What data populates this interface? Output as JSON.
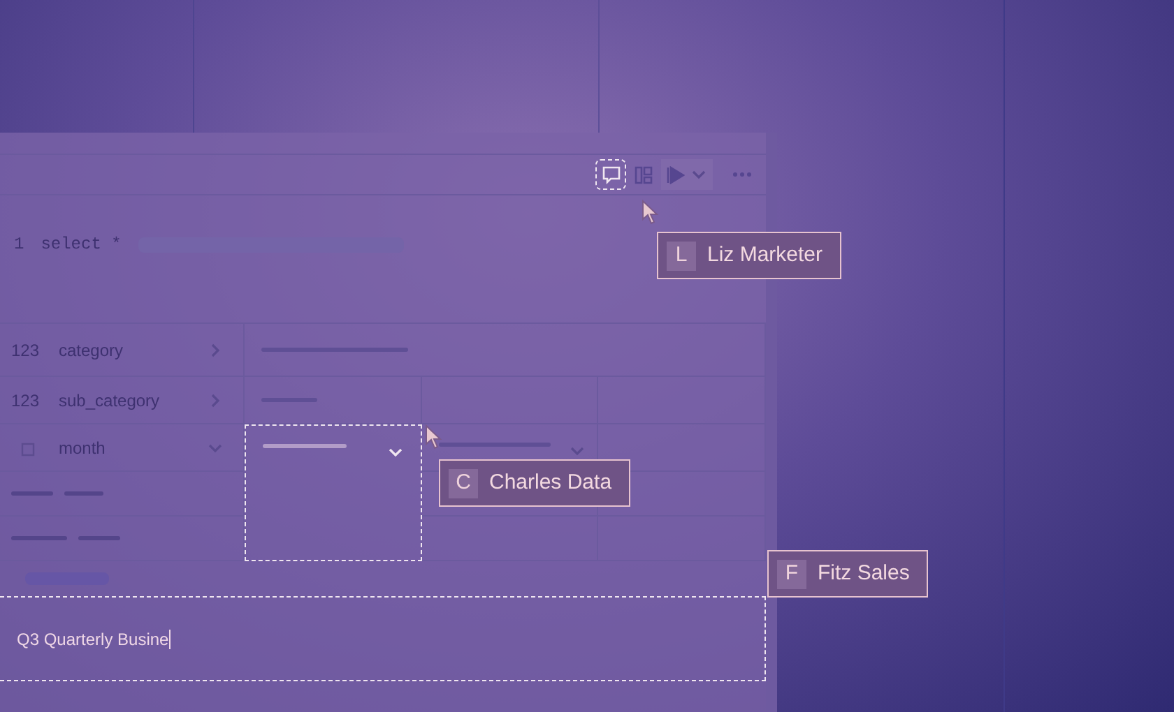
{
  "toolbar": {
    "comment_selected": true
  },
  "editor": {
    "lines": [
      {
        "number": "1",
        "code": "select *"
      }
    ]
  },
  "fields": [
    {
      "kind": "number",
      "type_label": "123",
      "name": "category",
      "expanded": false
    },
    {
      "kind": "number",
      "type_label": "123",
      "name": "sub_category",
      "expanded": false
    },
    {
      "kind": "date",
      "name": "month",
      "expanded": true
    }
  ],
  "title_input": {
    "value": "Q3 Quarterly Busine"
  },
  "collaborators": [
    {
      "initial": "L",
      "name": "Liz Marketer"
    },
    {
      "initial": "C",
      "name": "Charles Data"
    },
    {
      "initial": "F",
      "name": "Fitz Sales"
    }
  ]
}
